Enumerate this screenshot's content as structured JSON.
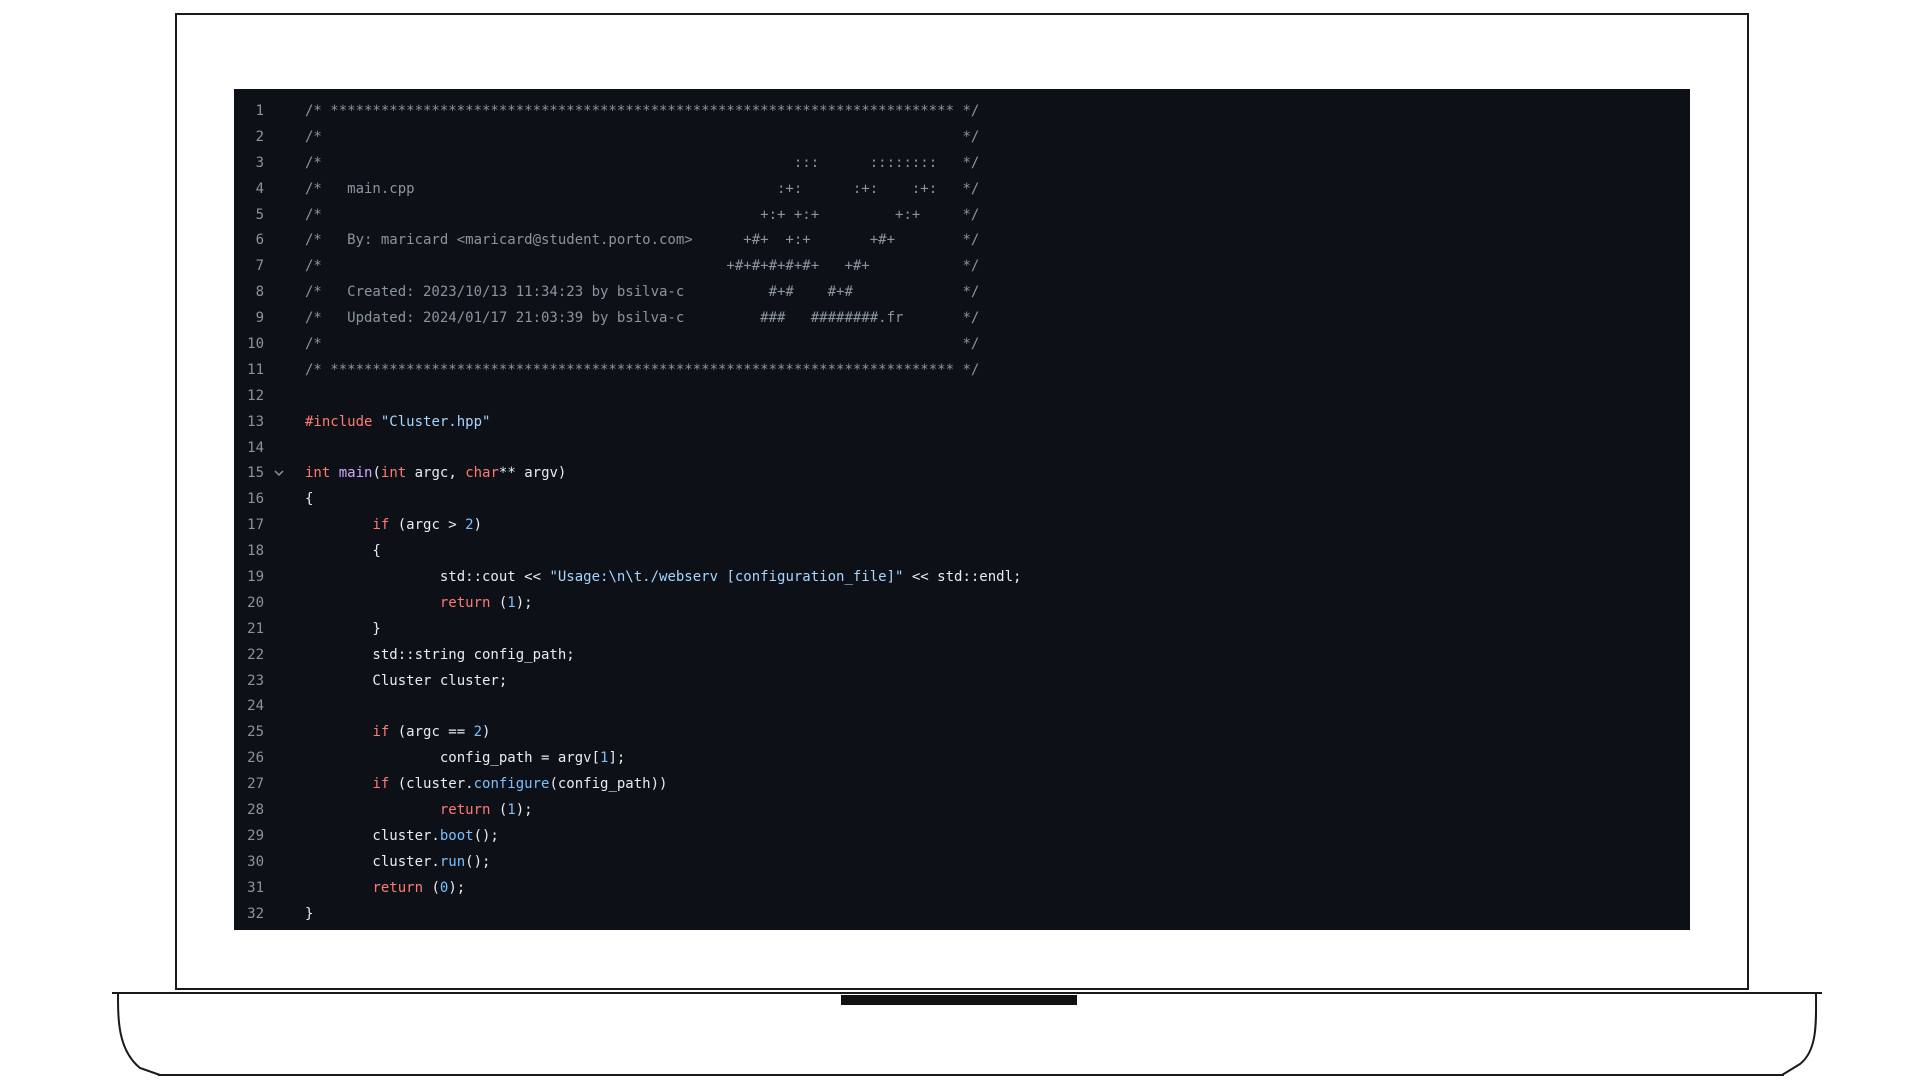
{
  "editor": {
    "fold_icon": "chevron-down-icon",
    "colors": {
      "background": "#0d1117",
      "line_number": "#8b949e",
      "comment": "#8b949e",
      "keyword": "#ff7b72",
      "string": "#a5d6ff",
      "function": "#d2a8ff",
      "number": "#79c0ff",
      "text": "#e6edf3"
    },
    "lines": [
      {
        "n": "1",
        "tokens": [
          {
            "t": "/* ************************************************************************** */",
            "c": "comment"
          }
        ]
      },
      {
        "n": "2",
        "tokens": [
          {
            "t": "/*                                                                            */",
            "c": "comment"
          }
        ]
      },
      {
        "n": "3",
        "tokens": [
          {
            "t": "/*                                                        :::      ::::::::   */",
            "c": "comment"
          }
        ]
      },
      {
        "n": "4",
        "tokens": [
          {
            "t": "/*   main.cpp                                           :+:      :+:    :+:   */",
            "c": "comment"
          }
        ]
      },
      {
        "n": "5",
        "tokens": [
          {
            "t": "/*                                                    +:+ +:+         +:+     */",
            "c": "comment"
          }
        ]
      },
      {
        "n": "6",
        "tokens": [
          {
            "t": "/*   By: maricard <maricard@student.porto.com>      +#+  +:+       +#+        */",
            "c": "comment"
          }
        ]
      },
      {
        "n": "7",
        "tokens": [
          {
            "t": "/*                                                +#+#+#+#+#+   +#+           */",
            "c": "comment"
          }
        ]
      },
      {
        "n": "8",
        "tokens": [
          {
            "t": "/*   Created: 2023/10/13 11:34:23 by bsilva-c          #+#    #+#             */",
            "c": "comment"
          }
        ]
      },
      {
        "n": "9",
        "tokens": [
          {
            "t": "/*   Updated: 2024/01/17 21:03:39 by bsilva-c         ###   ########.fr       */",
            "c": "comment"
          }
        ]
      },
      {
        "n": "10",
        "tokens": [
          {
            "t": "/*                                                                            */",
            "c": "comment"
          }
        ]
      },
      {
        "n": "11",
        "tokens": [
          {
            "t": "/* ************************************************************************** */",
            "c": "comment"
          }
        ]
      },
      {
        "n": "12",
        "tokens": []
      },
      {
        "n": "13",
        "tokens": [
          {
            "t": "#include",
            "c": "kw"
          },
          {
            "t": " ",
            "c": "plain"
          },
          {
            "t": "\"Cluster.hpp\"",
            "c": "str"
          }
        ]
      },
      {
        "n": "14",
        "tokens": []
      },
      {
        "n": "15",
        "fold": true,
        "tokens": [
          {
            "t": "int",
            "c": "kw"
          },
          {
            "t": " ",
            "c": "plain"
          },
          {
            "t": "main",
            "c": "fn"
          },
          {
            "t": "(",
            "c": "plain"
          },
          {
            "t": "int",
            "c": "kw"
          },
          {
            "t": " argc, ",
            "c": "plain"
          },
          {
            "t": "char",
            "c": "kw"
          },
          {
            "t": "** argv)",
            "c": "plain"
          }
        ]
      },
      {
        "n": "16",
        "tokens": [
          {
            "t": "{",
            "c": "plain"
          }
        ]
      },
      {
        "n": "17",
        "tokens": [
          {
            "t": "        ",
            "c": "plain"
          },
          {
            "t": "if",
            "c": "kw"
          },
          {
            "t": " (argc > ",
            "c": "plain"
          },
          {
            "t": "2",
            "c": "num"
          },
          {
            "t": ")",
            "c": "plain"
          }
        ]
      },
      {
        "n": "18",
        "tokens": [
          {
            "t": "        {",
            "c": "plain"
          }
        ]
      },
      {
        "n": "19",
        "tokens": [
          {
            "t": "                std::cout << ",
            "c": "plain"
          },
          {
            "t": "\"Usage:\\n\\t./webserv [configuration_file]\"",
            "c": "str"
          },
          {
            "t": " << std::endl;",
            "c": "plain"
          }
        ]
      },
      {
        "n": "20",
        "tokens": [
          {
            "t": "                ",
            "c": "plain"
          },
          {
            "t": "return",
            "c": "kw"
          },
          {
            "t": " (",
            "c": "plain"
          },
          {
            "t": "1",
            "c": "num"
          },
          {
            "t": ");",
            "c": "plain"
          }
        ]
      },
      {
        "n": "21",
        "tokens": [
          {
            "t": "        }",
            "c": "plain"
          }
        ]
      },
      {
        "n": "22",
        "tokens": [
          {
            "t": "        std::string config_path;",
            "c": "plain"
          }
        ]
      },
      {
        "n": "23",
        "tokens": [
          {
            "t": "        Cluster cluster;",
            "c": "plain"
          }
        ]
      },
      {
        "n": "24",
        "tokens": []
      },
      {
        "n": "25",
        "tokens": [
          {
            "t": "        ",
            "c": "plain"
          },
          {
            "t": "if",
            "c": "kw"
          },
          {
            "t": " (argc == ",
            "c": "plain"
          },
          {
            "t": "2",
            "c": "num"
          },
          {
            "t": ")",
            "c": "plain"
          }
        ]
      },
      {
        "n": "26",
        "tokens": [
          {
            "t": "                config_path = argv[",
            "c": "plain"
          },
          {
            "t": "1",
            "c": "num"
          },
          {
            "t": "];",
            "c": "plain"
          }
        ]
      },
      {
        "n": "27",
        "tokens": [
          {
            "t": "        ",
            "c": "plain"
          },
          {
            "t": "if",
            "c": "kw"
          },
          {
            "t": " (cluster.",
            "c": "plain"
          },
          {
            "t": "configure",
            "c": "call"
          },
          {
            "t": "(config_path))",
            "c": "plain"
          }
        ]
      },
      {
        "n": "28",
        "tokens": [
          {
            "t": "                ",
            "c": "plain"
          },
          {
            "t": "return",
            "c": "kw"
          },
          {
            "t": " (",
            "c": "plain"
          },
          {
            "t": "1",
            "c": "num"
          },
          {
            "t": ");",
            "c": "plain"
          }
        ]
      },
      {
        "n": "29",
        "tokens": [
          {
            "t": "        cluster.",
            "c": "plain"
          },
          {
            "t": "boot",
            "c": "call"
          },
          {
            "t": "();",
            "c": "plain"
          }
        ]
      },
      {
        "n": "30",
        "tokens": [
          {
            "t": "        cluster.",
            "c": "plain"
          },
          {
            "t": "run",
            "c": "call"
          },
          {
            "t": "();",
            "c": "plain"
          }
        ]
      },
      {
        "n": "31",
        "tokens": [
          {
            "t": "        ",
            "c": "plain"
          },
          {
            "t": "return",
            "c": "kw"
          },
          {
            "t": " (",
            "c": "plain"
          },
          {
            "t": "0",
            "c": "num"
          },
          {
            "t": ");",
            "c": "plain"
          }
        ]
      },
      {
        "n": "32",
        "tokens": [
          {
            "t": "}",
            "c": "plain"
          }
        ]
      }
    ]
  }
}
